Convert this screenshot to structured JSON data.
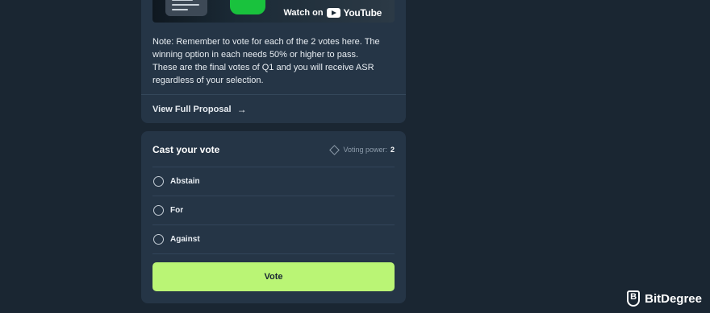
{
  "video": {
    "watch_label": "Watch on",
    "platform": "YouTube"
  },
  "proposal": {
    "note_lines": [
      "Note: Remember to vote for each of the 2 votes here. The",
      "winning option in each needs 50% or higher to pass.",
      "These are the final votes of Q1 and you will receive ASR",
      "regardless of your selection."
    ],
    "view_full_label": "View Full Proposal",
    "view_full_icon": "arrow-right-icon"
  },
  "vote": {
    "title": "Cast your vote",
    "voting_power_label": "Voting power:",
    "voting_power_value": "2",
    "options": [
      {
        "label": "Abstain",
        "selected": false
      },
      {
        "label": "For",
        "selected": false
      },
      {
        "label": "Against",
        "selected": false
      }
    ],
    "button_label": "Vote",
    "button_color": "#baf575"
  },
  "watermark": {
    "brand": "BitDegree"
  },
  "colors": {
    "background": "#1a2632",
    "card": "#253546",
    "accent": "#baf575"
  }
}
